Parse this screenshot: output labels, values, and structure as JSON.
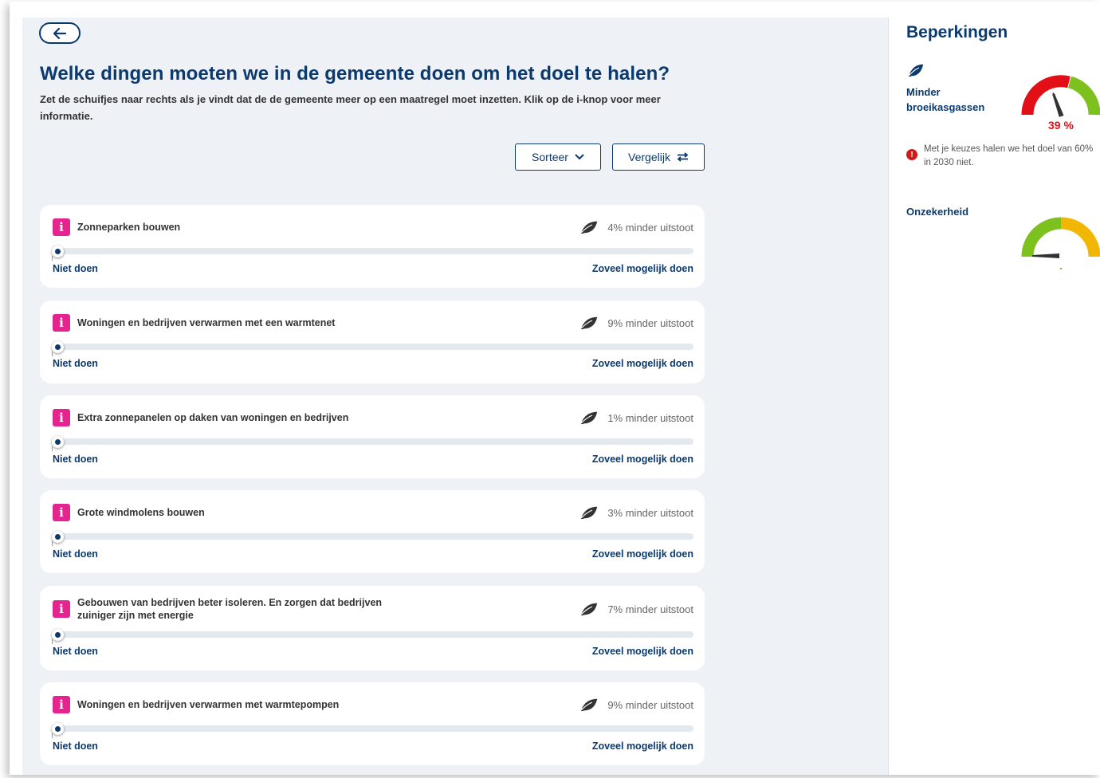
{
  "header": {
    "title": "Welke dingen moeten we in de gemeente doen om het doel te halen?",
    "intro": "Zet de schuifjes naar rechts als je vindt dat de de gemeente meer op een maatregel moet inzetten. Klik op de i-knop voor meer informatie."
  },
  "toolbar": {
    "sort_label": "Sorteer",
    "compare_label": "Vergelijk"
  },
  "measures": [
    {
      "label": "Zonneparken bouwen",
      "impact": "4% minder uitstoot",
      "slider_value": 0,
      "min_label": "Niet doen",
      "max_label": "Zoveel mogelijk doen"
    },
    {
      "label": "Woningen en bedrijven verwarmen met een warmtenet",
      "impact": "9% minder uitstoot",
      "slider_value": 0,
      "min_label": "Niet doen",
      "max_label": "Zoveel mogelijk doen"
    },
    {
      "label": "Extra zonnepanelen op daken van woningen en bedrijven",
      "impact": "1% minder uitstoot",
      "slider_value": 0,
      "min_label": "Niet doen",
      "max_label": "Zoveel mogelijk doen"
    },
    {
      "label": "Grote windmolens bouwen",
      "impact": "3% minder uitstoot",
      "slider_value": 0,
      "min_label": "Niet doen",
      "max_label": "Zoveel mogelijk doen"
    },
    {
      "label": "Gebouwen van bedrijven beter isoleren. En zorgen dat bedrijven zuiniger zijn met energie",
      "impact": "7% minder uitstoot",
      "slider_value": 0,
      "min_label": "Niet doen",
      "max_label": "Zoveel mogelijk doen"
    },
    {
      "label": "Woningen en bedrijven verwarmen met warmtepompen",
      "impact": "9% minder uitstoot",
      "slider_value": 0,
      "min_label": "Niet doen",
      "max_label": "Zoveel mogelijk doen"
    }
  ],
  "sidebar": {
    "title": "Beperkingen",
    "emissions": {
      "label_line1": "Minder",
      "label_line2": "broeikasgassen",
      "percent": "39 %",
      "gauge_value": 0.39
    },
    "warning": "Met je keuzes halen we het doel van 60% in 2030 niet.",
    "uncertainty": {
      "label": "Onzekerheid",
      "gauge_value": 0.0
    }
  },
  "colors": {
    "primary": "#0b3a6e",
    "info_badge": "#e6248f",
    "gauge_red": "#e30f17",
    "gauge_green": "#7cc11e",
    "gauge_yellow": "#f2b705",
    "background_main": "#eef1f6"
  },
  "icons": {
    "back": "arrow-left-icon",
    "sort": "chevron-down-icon",
    "compare": "swap-arrows-icon",
    "info": "info-icon",
    "impact": "leaf-icon",
    "warning": "alert-icon"
  }
}
